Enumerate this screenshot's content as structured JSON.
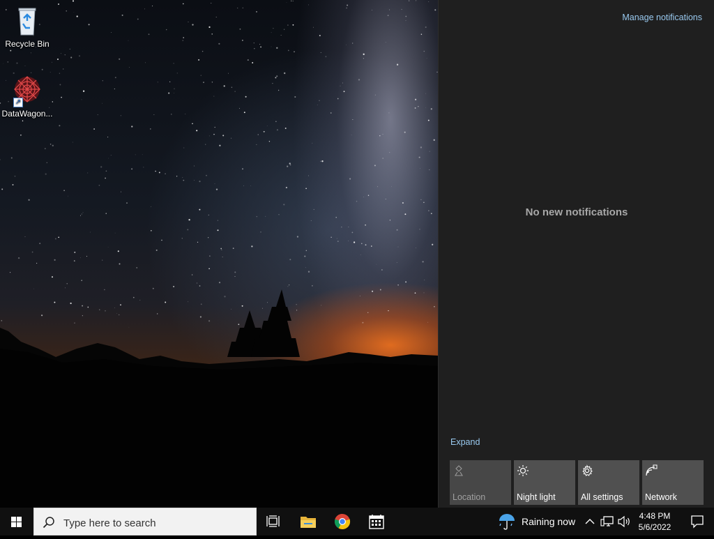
{
  "desktop": {
    "icons": [
      {
        "label": "Recycle Bin",
        "icon": "recycle-bin-icon"
      },
      {
        "label": "DataWagon...",
        "icon": "datawagon-app-icon"
      }
    ]
  },
  "action_center": {
    "manage_link": "Manage notifications",
    "empty_message": "No new notifications",
    "expand_link": "Expand",
    "quick_actions": [
      {
        "label": "Location",
        "icon": "location-icon",
        "enabled": false
      },
      {
        "label": "Night light",
        "icon": "night-light-icon",
        "enabled": true
      },
      {
        "label": "All settings",
        "icon": "settings-gear-icon",
        "enabled": true
      },
      {
        "label": "Network",
        "icon": "network-icon",
        "enabled": true
      }
    ]
  },
  "taskbar": {
    "search_placeholder": "Type here to search",
    "pinned": [
      {
        "name": "Task View",
        "icon": "task-view-icon"
      },
      {
        "name": "File Explorer",
        "icon": "file-explorer-icon"
      },
      {
        "name": "Google Chrome",
        "icon": "chrome-icon"
      },
      {
        "name": "Calendar",
        "icon": "calendar-icon"
      }
    ],
    "weather": {
      "text": "Raining now",
      "icon": "umbrella-rain-icon"
    },
    "clock": {
      "time": "4:48 PM",
      "date": "5/6/2022"
    }
  },
  "colors": {
    "action_center_bg": "#1f1f1f",
    "link": "#99c9ef",
    "taskbar_bg": "#101010",
    "tile_bg": "#505050"
  }
}
